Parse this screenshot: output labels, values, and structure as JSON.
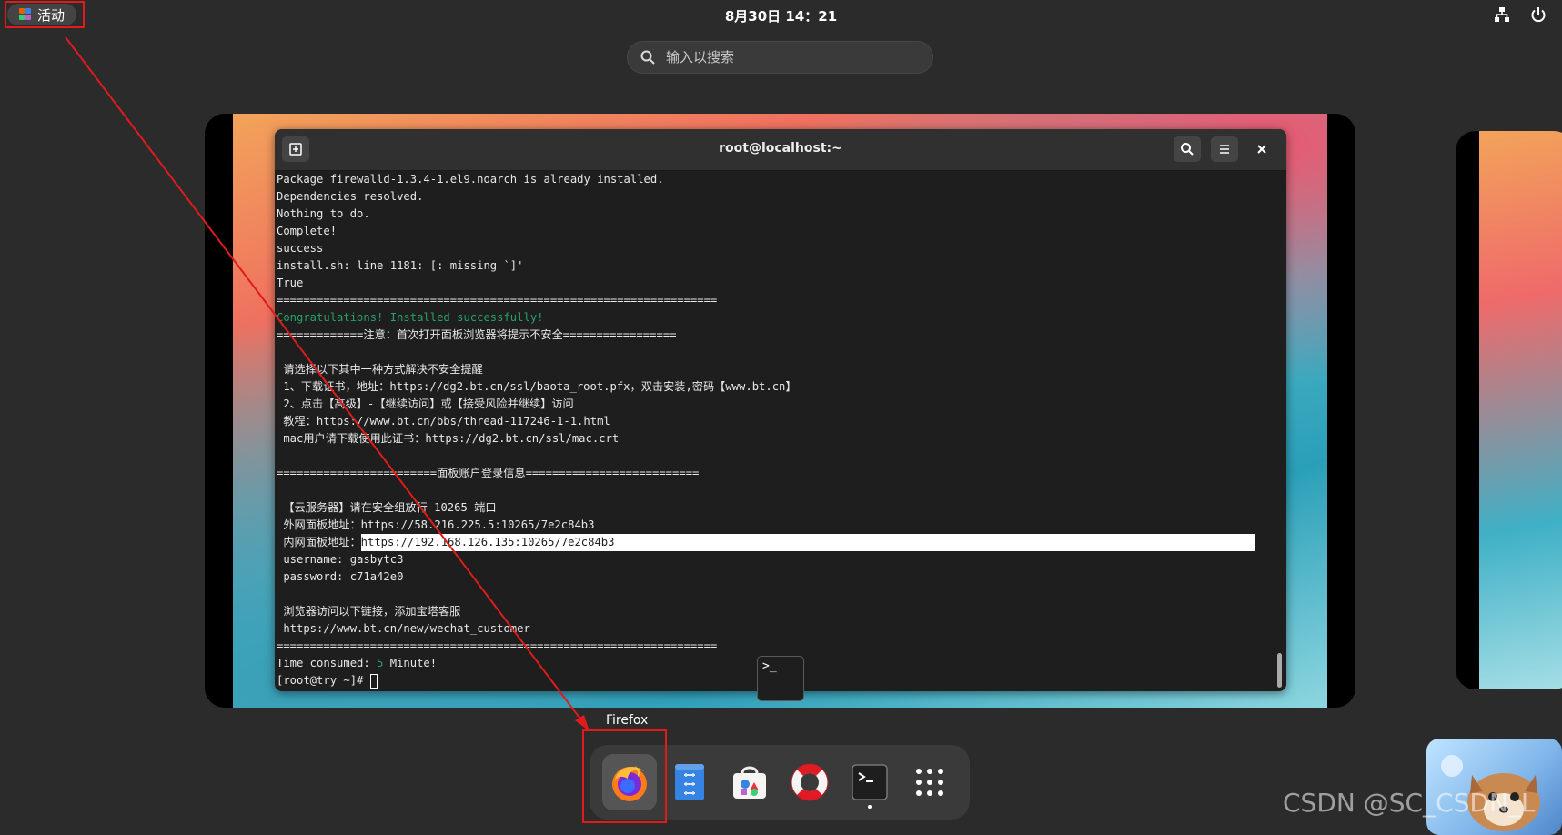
{
  "topbar": {
    "activities_label": "活动",
    "clock": "8月30日  14：21"
  },
  "search": {
    "placeholder": "输入以搜索"
  },
  "terminal": {
    "title": "root@localhost:~",
    "lines": [
      "Package firewalld-1.3.4-1.el9.noarch is already installed.",
      "Dependencies resolved.",
      "Nothing to do.",
      "Complete!",
      "success",
      "install.sh: line 1181: [: missing `]'",
      "True",
      "==================================================================",
      "Congratulations! Installed successfully!",
      "=============注意：首次打开面板浏览器将提示不安全=================",
      "",
      " 请选择以下其中一种方式解决不安全提醒",
      " 1、下载证书，地址：https://dg2.bt.cn/ssl/baota_root.pfx，双击安装,密码【www.bt.cn】",
      " 2、点击【高级】-【继续访问】或【接受风险并继续】访问",
      " 教程：https://www.bt.cn/bbs/thread-117246-1-1.html",
      " mac用户请下载使用此证书：https://dg2.bt.cn/ssl/mac.crt",
      "",
      "========================面板账户登录信息==========================",
      "",
      " 【云服务器】请在安全组放行 10265 端口",
      " 外网面板地址：https://58.216.225.5:10265/7e2c84b3"
    ],
    "inner_label": " 内网面板地址：",
    "inner_url": "https://192.168.126.135:10265/7e2c84b3",
    "lines2": [
      " username: gasbytc3",
      " password: c71a42e0",
      "",
      " 浏览器访问以下链接，添加宝塔客服",
      " https://www.bt.cn/new/wechat_customer",
      "=================================================================="
    ],
    "time_prefix": "Time consumed: ",
    "time_value": "5",
    "time_suffix": " Minute!",
    "prompt": "[root@try ~]# "
  },
  "dash": {
    "tooltip": "Firefox",
    "apps": [
      "firefox",
      "files",
      "software",
      "help",
      "terminal",
      "show-apps"
    ]
  },
  "terminal_thumb_label": ">_",
  "watermark": "CSDN @SC_CSDN_L",
  "colors": {
    "highlight": "#e01b1b",
    "accent_green": "#26a269"
  }
}
